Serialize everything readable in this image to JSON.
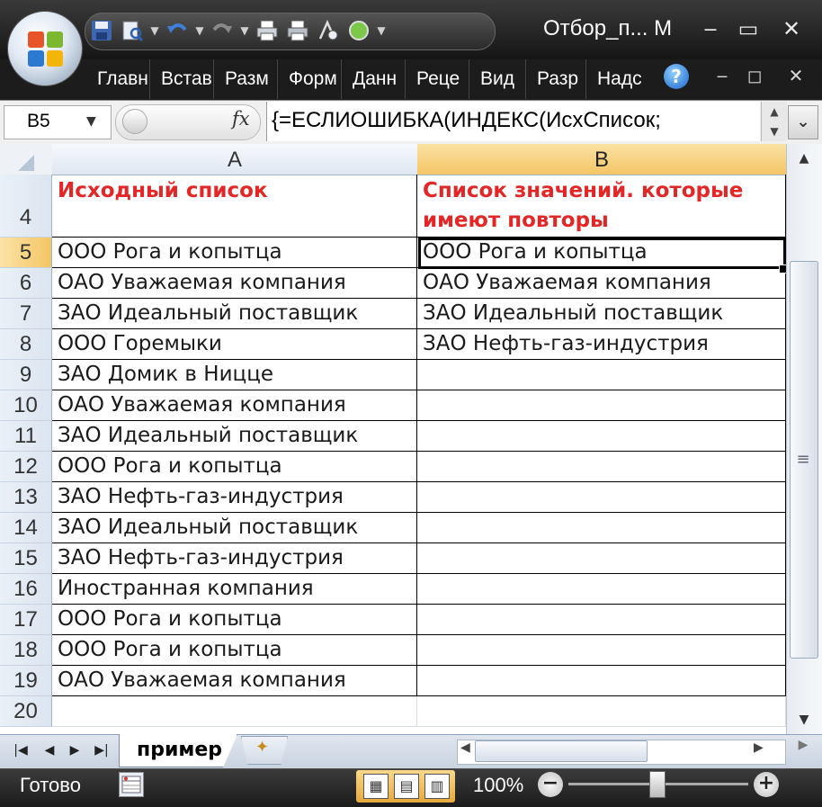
{
  "window": {
    "title": "Отбор_п... M",
    "minimize": "‒",
    "maximize": "▭",
    "close": "✕"
  },
  "qat": {
    "icons": [
      "save-icon",
      "print-preview-icon",
      "undo-icon",
      "redo-icon",
      "quick-print-icon",
      "print-icon",
      "spellcheck-icon",
      "circle-icon"
    ]
  },
  "ribbon": {
    "tabs": [
      "Главн",
      "Встав",
      "Разм",
      "Форм",
      "Данн",
      "Реце",
      "Вид",
      "Разр",
      "Надс"
    ],
    "help": "?",
    "minimize": "‒",
    "restore": "◻",
    "close": "✕"
  },
  "formula_bar": {
    "name_box": "B5",
    "fx_label": "fx",
    "formula": "{=ЕСЛИОШИБКА(ИНДЕКС(ИсхСписок;"
  },
  "sheet": {
    "columns": [
      "A",
      "B"
    ],
    "selected_column": "B",
    "selected_row": "5",
    "header_row": {
      "row": "4",
      "a": "Исходный список",
      "b": "Список значений. которые имеют повторы"
    },
    "rows": [
      {
        "n": "5",
        "a": "ООО Рога и копытца",
        "b": "ООО Рога и копытца"
      },
      {
        "n": "6",
        "a": "ОАО Уважаемая компания",
        "b": "ОАО Уважаемая компания"
      },
      {
        "n": "7",
        "a": "ЗАО Идеальный поставщик",
        "b": "ЗАО Идеальный поставщик"
      },
      {
        "n": "8",
        "a": "ООО Горемыки",
        "b": "ЗАО Нефть-газ-индустрия"
      },
      {
        "n": "9",
        "a": "ЗАО Домик в Ницце",
        "b": ""
      },
      {
        "n": "10",
        "a": "ОАО Уважаемая компания",
        "b": ""
      },
      {
        "n": "11",
        "a": "ЗАО Идеальный поставщик",
        "b": ""
      },
      {
        "n": "12",
        "a": "ООО Рога и копытца",
        "b": ""
      },
      {
        "n": "13",
        "a": "ЗАО Нефть-газ-индустрия",
        "b": ""
      },
      {
        "n": "14",
        "a": "ЗАО Идеальный поставщик",
        "b": ""
      },
      {
        "n": "15",
        "a": "ЗАО Нефть-газ-индустрия",
        "b": ""
      },
      {
        "n": "16",
        "a": "Иностранная компания",
        "b": ""
      },
      {
        "n": "17",
        "a": "ООО Рога и копытца",
        "b": ""
      },
      {
        "n": "18",
        "a": "ООО Рога и копытца",
        "b": ""
      },
      {
        "n": "19",
        "a": "ОАО Уважаемая компания",
        "b": ""
      },
      {
        "n": "20",
        "a": "",
        "b": ""
      }
    ],
    "sheet_tab": "пример"
  },
  "status": {
    "ready": "Готово",
    "zoom": "100%",
    "zoom_minus": "−",
    "zoom_plus": "+"
  },
  "colors": {
    "header_text": "#e32626",
    "selected_header": "#f5c565"
  }
}
